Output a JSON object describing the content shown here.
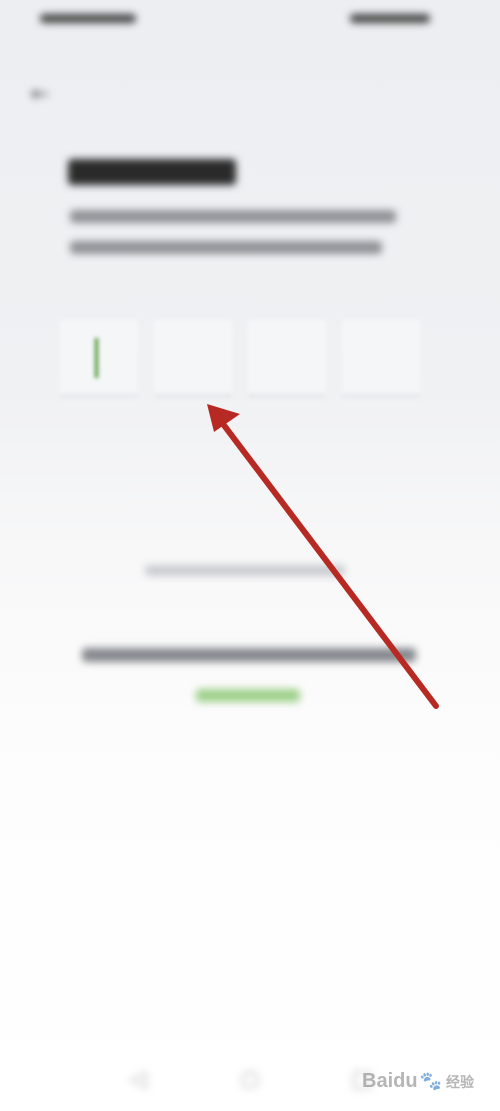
{
  "status_bar": {
    "left": "",
    "right": ""
  },
  "header": {
    "back_icon": "back-arrow-icon",
    "back_glyph": "←",
    "title": "输入验证码"
  },
  "main": {
    "description": "",
    "code_inputs": [
      {
        "value": "",
        "active": true
      },
      {
        "value": "",
        "active": false
      },
      {
        "value": "",
        "active": false
      },
      {
        "value": "",
        "active": false
      }
    ],
    "helper_text": "",
    "tip_text": "",
    "link_text": ""
  },
  "annotation": {
    "type": "arrow",
    "color": "#b72a24"
  },
  "watermark": {
    "brand": "Baidu",
    "suffix": "经验"
  },
  "colors": {
    "accent": "#3e8b1f",
    "link": "#9dd089",
    "background": "#eceef1"
  }
}
